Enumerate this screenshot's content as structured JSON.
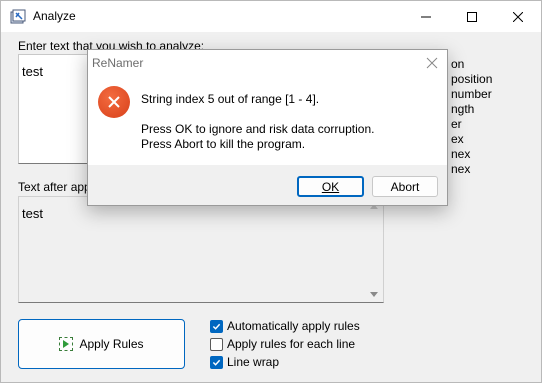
{
  "window": {
    "title": "Analyze"
  },
  "input": {
    "label": "Enter text that you wish to analyze:",
    "value": "test"
  },
  "output": {
    "label": "Text after app",
    "value": "test"
  },
  "side_list": [
    "on",
    "position",
    "number",
    "ngth",
    "er",
    "ex",
    "nex",
    "nex"
  ],
  "apply_button": {
    "label": "Apply Rules"
  },
  "options": [
    {
      "label": "Automatically apply rules",
      "checked": true
    },
    {
      "label": "Apply rules for each line",
      "checked": false
    },
    {
      "label": "Line wrap",
      "checked": true
    }
  ],
  "dialog": {
    "title": "ReNamer",
    "message_line1": "String index 5 out of range [1 - 4].",
    "message_line2": "Press OK to ignore and risk data corruption.",
    "message_line3": "Press Abort to kill the program.",
    "ok_label": "OK",
    "abort_label": "Abort"
  }
}
